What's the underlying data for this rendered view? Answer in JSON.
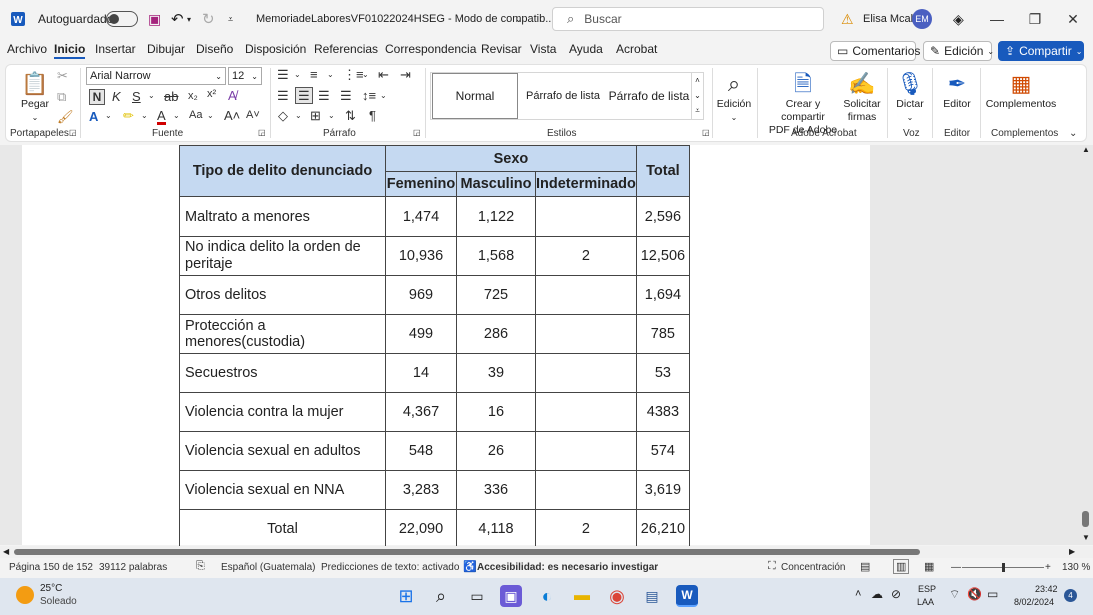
{
  "titlebar": {
    "autosave_label": "Autoguardado",
    "doc_title": "MemoriadeLaboresVF01022024HSEG  -  Modo de compatib...",
    "search_placeholder": "Buscar",
    "user_name": "Elisa Mcal",
    "user_initials": "EM",
    "minimize": "—",
    "restore": "❐",
    "close": "✕"
  },
  "menu": {
    "items": [
      "Archivo",
      "Inicio",
      "Insertar",
      "Dibujar",
      "Diseño",
      "Disposición",
      "Referencias",
      "Correspondencia",
      "Revisar",
      "Vista",
      "Ayuda",
      "Acrobat"
    ],
    "comments": "Comentarios",
    "edit_mode": "Edición",
    "share": "Compartir"
  },
  "ribbon": {
    "paste": "Pegar",
    "font_name": "Arial Narrow",
    "font_size": "12",
    "styles": [
      "Normal",
      "Párrafo de lista",
      "Párrafo de lista"
    ],
    "edicion": "Edición",
    "create_pdf": [
      "Crear y compartir",
      "PDF de Adobe"
    ],
    "request_sign": [
      "Solicitar",
      "firmas"
    ],
    "dictate": "Dictar",
    "editor": "Editor",
    "addins": "Complementos",
    "groups": {
      "clipboard": "Portapapeles",
      "font": "Fuente",
      "paragraph": "Párrafo",
      "styles": "Estilos",
      "acrobat": "Adobe Acrobat",
      "voice": "Voz",
      "editor": "Editor",
      "addins": "Complementos"
    }
  },
  "table": {
    "header_type": "Tipo de delito denunciado",
    "header_sex": "Sexo",
    "header_total": "Total",
    "sub_headers": [
      "Femenino",
      "Masculino",
      "Indeterminado"
    ],
    "rows": [
      {
        "label": "Maltrato a menores",
        "fem": "1,474",
        "mas": "1,122",
        "ind": "",
        "total": "2,596"
      },
      {
        "label": "No indica delito la orden de peritaje",
        "fem": "10,936",
        "mas": "1,568",
        "ind": "2",
        "total": "12,506"
      },
      {
        "label": "Otros delitos",
        "fem": "969",
        "mas": "725",
        "ind": "",
        "total": "1,694"
      },
      {
        "label": "Protección a menores(custodia)",
        "fem": "499",
        "mas": "286",
        "ind": "",
        "total": "785"
      },
      {
        "label": "Secuestros",
        "fem": "14",
        "mas": "39",
        "ind": "",
        "total": "53"
      },
      {
        "label": "Violencia contra la mujer",
        "fem": "4,367",
        "mas": "16",
        "ind": "",
        "total": "4383"
      },
      {
        "label": "Violencia sexual en adultos",
        "fem": "548",
        "mas": "26",
        "ind": "",
        "total": "574"
      },
      {
        "label": "Violencia sexual en NNA",
        "fem": "3,283",
        "mas": "336",
        "ind": "",
        "total": "3,619"
      }
    ],
    "total_row": {
      "label": "Total",
      "fem": "22,090",
      "mas": "4,118",
      "ind": "2",
      "total": "26,210"
    }
  },
  "statusbar": {
    "page": "Página 150 de 152",
    "words": "39112 palabras",
    "language": "Español (Guatemala)",
    "predictions": "Predicciones de texto: activado",
    "accessibility": "Accesibilidad: es necesario investigar",
    "focus": "Concentración",
    "zoom": "130 %"
  },
  "taskbar": {
    "temp": "25°C",
    "weather": "Soleado",
    "lang1": "ESP",
    "lang2": "LAA",
    "time": "23:42",
    "date": "8/02/2024",
    "notifications": "4"
  }
}
